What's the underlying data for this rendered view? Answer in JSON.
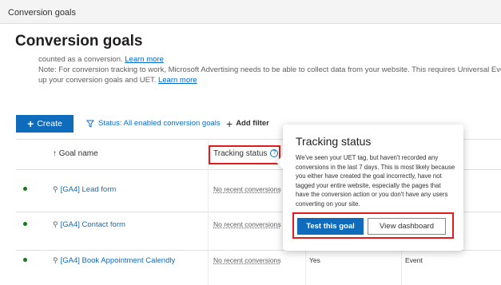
{
  "topbar": {
    "breadcrumb": "Conversion goals"
  },
  "page": {
    "title": "Conversion goals"
  },
  "info": {
    "line1_text": "counted as a conversion. ",
    "line1_link": "Learn more",
    "line2_text": "Note: For conversion tracking to work, Microsoft Advertising needs to be able to collect data from your website. This requires Universal Event",
    "line3_text": "up your conversion goals and UET. ",
    "line3_link": "Learn more"
  },
  "toolbar": {
    "create_label": "Create",
    "filter_label": "Status: All enabled conversion goals",
    "add_filter_label": "Add filter"
  },
  "table": {
    "headers": {
      "goal_name": "Goal name",
      "tracking_status": "Tracking status"
    },
    "rows": [
      {
        "name": "[GA4] Lead form",
        "status": "No recent conversions",
        "c4": "",
        "c5": ""
      },
      {
        "name": "[GA4] Contact form",
        "status": "No recent conversions",
        "c4": "",
        "c5": ""
      },
      {
        "name": "[GA4] Book Appointment Calendly",
        "status": "No recent conversions",
        "c4": "Yes",
        "c5": "Event"
      }
    ]
  },
  "popover": {
    "title": "Tracking status",
    "body": "We've seen your UET tag, but haven't recorded any conversions in the last 7 days. This is most likely because you either have created the goal incorrectly, have not tagged your entire website, especially the pages that have the conversion action or you don't have any users converting on your site.",
    "primary_label": "Test this goal",
    "secondary_label": "View dashboard"
  },
  "colors": {
    "accent": "#0f6cbd",
    "highlight": "#e01c1c",
    "status_ok": "#107c10"
  }
}
